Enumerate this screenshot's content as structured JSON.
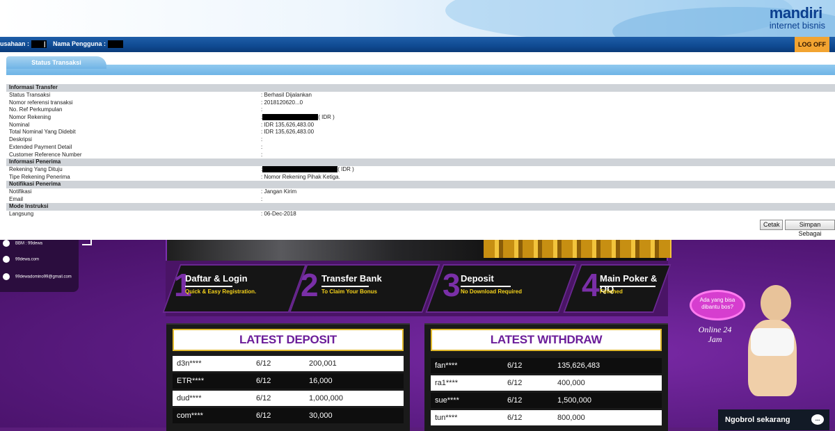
{
  "header": {
    "brand": "mandiri",
    "brand_sub": "internet bisnis",
    "company_label": "usahaan :",
    "user_label": "Nama Pengguna :",
    "separator": "|",
    "logoff": "LOG OFF",
    "tab": "Status Transaksi"
  },
  "transfer": {
    "rows": [
      {
        "type": "section",
        "label": "Informasi Transfer",
        "value": ""
      },
      {
        "type": "field",
        "label": "Status Transaksi",
        "value": ": Berhasil Dijalankan"
      },
      {
        "type": "field",
        "label": "Nomor referensi transaksi",
        "value": ": 2018120620...0"
      },
      {
        "type": "field",
        "label": "No. Ref Perkumpulan",
        "value": ":"
      },
      {
        "type": "field",
        "label": "Nomor Rekening",
        "value": ":",
        "redacted": true,
        "suffix": "( IDR )"
      },
      {
        "type": "field",
        "label": "Nominal",
        "value": ": IDR   135,626,483.00"
      },
      {
        "type": "field",
        "label": "Total Nominal Yang Didebit",
        "value": ":  IDR 135,626,483.00"
      },
      {
        "type": "field",
        "label": "Deskripsi",
        "value": ":"
      },
      {
        "type": "field",
        "label": "Extended Payment Detail",
        "value": ":"
      },
      {
        "type": "field",
        "label": "Customer Reference Number",
        "value": ":"
      },
      {
        "type": "section",
        "label": "Informasi Penerima",
        "value": ""
      },
      {
        "type": "field",
        "label": "Rekening Yang Dituju",
        "value": ":",
        "redacted2": true,
        "suffix": "( IDR )"
      },
      {
        "type": "field",
        "label": "Tipe Rekening Penerima",
        "value": ": Nomor Rekening Pihak Ketiga."
      },
      {
        "type": "section",
        "label": "Notifikasi Penerima",
        "value": ""
      },
      {
        "type": "field",
        "label": "Notifikasi",
        "value": ": Jangan Kirim"
      },
      {
        "type": "field",
        "label": "Email",
        "value": ":"
      },
      {
        "type": "section",
        "label": "Mode Instruksi",
        "value": ""
      },
      {
        "type": "field",
        "label": "Langsung",
        "value": ": 06-Dec-2018"
      }
    ],
    "print_button": "Cetak",
    "save_button": "Simpan Sebagai"
  },
  "site": {
    "contacts": [
      "BBM : 99dewa",
      "99dewa.com",
      "99dewadomino99@gmail.com"
    ],
    "steps": [
      {
        "num": "1",
        "title": "Daftar & Login",
        "sub": "Quick & Easy Registration."
      },
      {
        "num": "2",
        "title": "Transfer Bank",
        "sub": "To Claim Your Bonus"
      },
      {
        "num": "3",
        "title": "Deposit",
        "sub": "No Download Required"
      },
      {
        "num": "4",
        "title": "Main Poker & QQ",
        "sub": "Finished"
      }
    ],
    "latest_deposit": {
      "title": "LATEST DEPOSIT",
      "rows": [
        {
          "user": "d3n****",
          "date": "6/12",
          "amount": "200,001"
        },
        {
          "user": "ETR****",
          "date": "6/12",
          "amount": "16,000"
        },
        {
          "user": "dud****",
          "date": "6/12",
          "amount": "1,000,000"
        },
        {
          "user": "com****",
          "date": "6/12",
          "amount": "30,000"
        }
      ]
    },
    "latest_withdraw": {
      "title": "LATEST WITHDRAW",
      "rows": [
        {
          "user": "fan****",
          "date": "6/12",
          "amount": "135,626,483"
        },
        {
          "user": "ra1****",
          "date": "6/12",
          "amount": "400,000"
        },
        {
          "user": "sue****",
          "date": "6/12",
          "amount": "1,500,000"
        },
        {
          "user": "tun****",
          "date": "6/12",
          "amount": "800,000"
        }
      ]
    },
    "chat_bubble": "Ada yang bisa dibantu bos?",
    "online_text": "Online 24 Jam",
    "chat_button": "Ngobrol sekarang",
    "chat_icon": "..."
  }
}
